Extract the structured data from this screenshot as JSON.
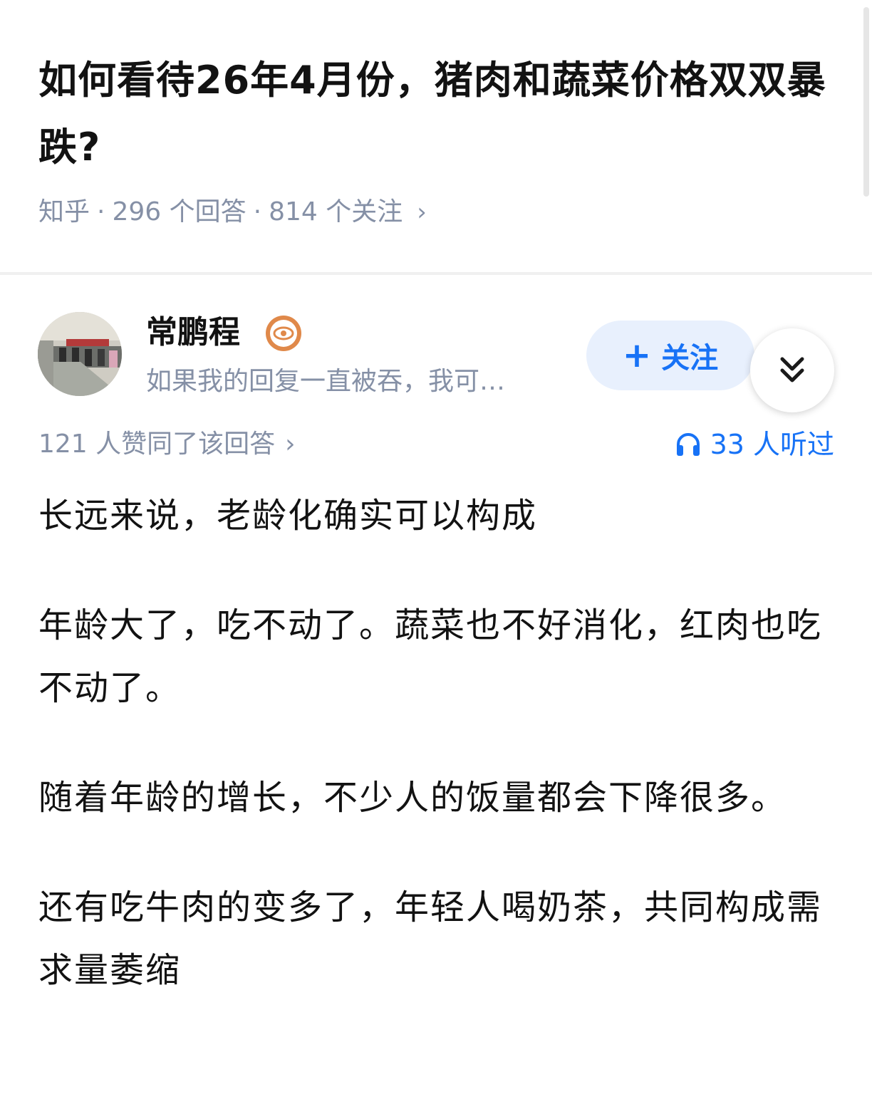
{
  "question": {
    "title": "如何看待26年4月份，猪肉和蔬菜价格双双暴跌?",
    "source": "知乎",
    "answer_count": "296 个回答",
    "follower_count": "814 个关注",
    "chevron": "›"
  },
  "author": {
    "name": "常鹏程",
    "bio": "如果我的回复一直被吞，我可…",
    "avatar_icon": "avatar-photo",
    "badge_icon": "eye-badge-icon"
  },
  "actions": {
    "follow_plus": "+",
    "follow_label": "关注",
    "collapse_icon": "double-chevron-down-icon"
  },
  "stats": {
    "upvotes": "121 人赞同了该回答",
    "chevron": "›",
    "listens": "33 人听过"
  },
  "answer": {
    "paragraphs": [
      "长远来说，老龄化确实可以构成",
      "年龄大了，吃不动了。蔬菜也不好消化，红肉也吃不动了。",
      "随着年龄的增长，不少人的饭量都会下降很多。",
      "还有吃牛肉的变多了，年轻人喝奶茶，共同构成需求量萎缩"
    ]
  },
  "colors": {
    "accent": "#1772f6",
    "follow_bg": "#e8f0fd",
    "meta_gray": "#8590a6",
    "badge_orange": "#e0894a"
  }
}
